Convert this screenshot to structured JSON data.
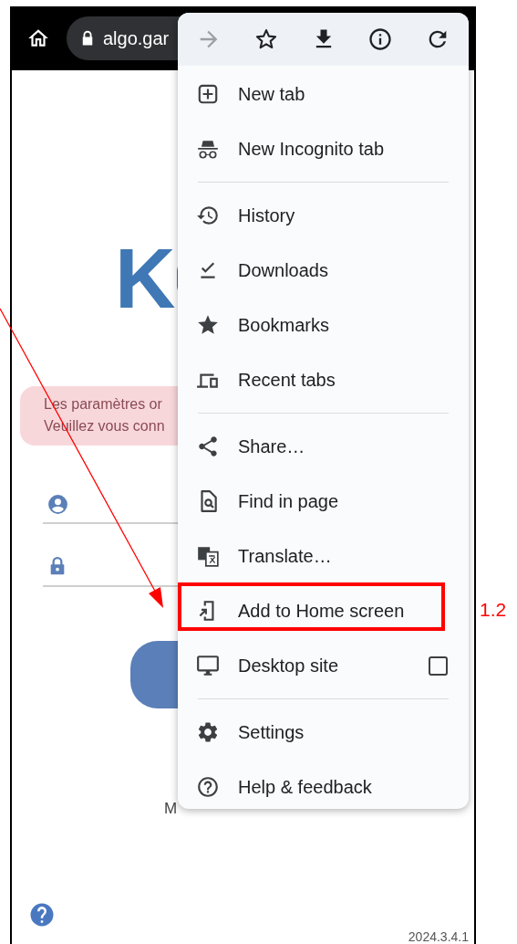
{
  "browser": {
    "url": "algo.gar"
  },
  "page": {
    "logo": "K",
    "alert_lines": [
      "Les paramètres or",
      "Veuillez vous conn"
    ],
    "partial_link": "M",
    "version": "2024.3.4.1"
  },
  "menu": {
    "toolbar": [
      {
        "kind": "forward",
        "disabled": true
      },
      {
        "kind": "star",
        "disabled": false
      },
      {
        "kind": "download",
        "disabled": false
      },
      {
        "kind": "info",
        "disabled": false
      },
      {
        "kind": "refresh",
        "disabled": false
      }
    ],
    "sections": [
      [
        {
          "kind": "new-tab",
          "label": "New tab"
        },
        {
          "kind": "incognito",
          "label": "New Incognito tab"
        }
      ],
      [
        {
          "kind": "history",
          "label": "History"
        },
        {
          "kind": "downloads",
          "label": "Downloads"
        },
        {
          "kind": "bookmarks",
          "label": "Bookmarks"
        },
        {
          "kind": "recent-tabs",
          "label": "Recent tabs"
        }
      ],
      [
        {
          "kind": "share",
          "label": "Share…"
        },
        {
          "kind": "find",
          "label": "Find in page"
        },
        {
          "kind": "translate",
          "label": "Translate…"
        },
        {
          "kind": "add-home",
          "label": "Add to Home screen"
        },
        {
          "kind": "desktop",
          "label": "Desktop site",
          "checkbox": {
            "checked": false
          }
        }
      ],
      [
        {
          "kind": "settings",
          "label": "Settings"
        },
        {
          "kind": "help",
          "label": "Help & feedback"
        }
      ]
    ]
  },
  "annotation": {
    "label": "1.2"
  }
}
